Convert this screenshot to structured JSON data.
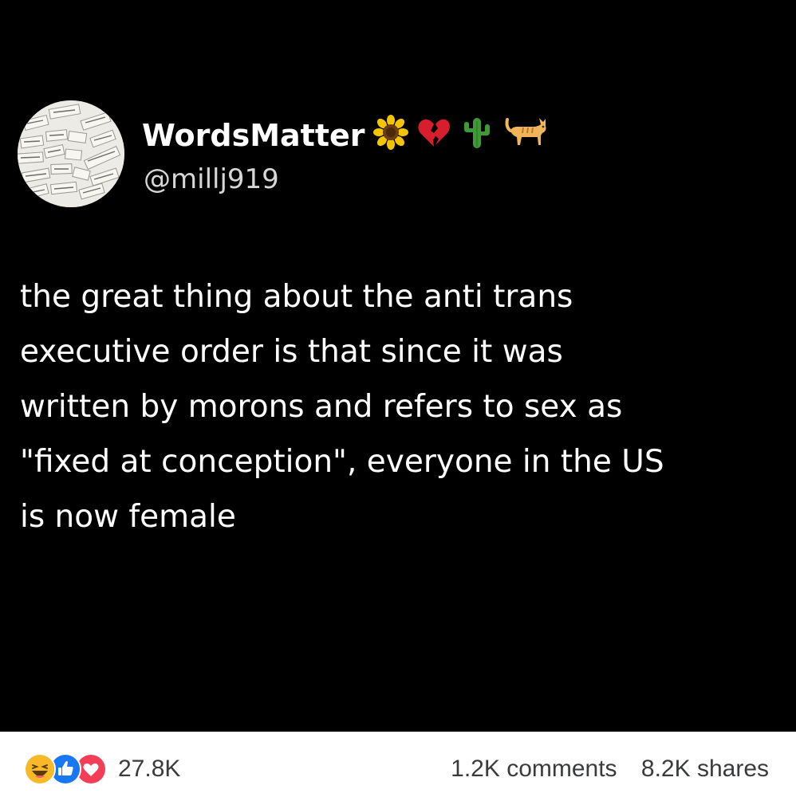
{
  "post": {
    "author_name": "WordsMatter",
    "author_handle": "@millj919",
    "name_emojis": [
      "sunflower-icon",
      "broken-heart-icon",
      "cactus-icon",
      "cat-icon"
    ],
    "text_lines": [
      "the great thing about the anti trans",
      "executive order is that since it was",
      "written by morons and refers to sex as",
      "\"fixed at conception\", everyone in the US",
      "is now female"
    ]
  },
  "footer": {
    "reaction_icons": [
      "haha-icon",
      "like-icon",
      "love-icon"
    ],
    "reaction_count": "27.8K",
    "comments": "1.2K comments",
    "shares": "8.2K shares"
  },
  "colors": {
    "background": "#000000",
    "text": "#ffffff",
    "like_blue": "#1877f2",
    "love_red": "#f33e58",
    "haha_yellow": "#f7b928"
  }
}
